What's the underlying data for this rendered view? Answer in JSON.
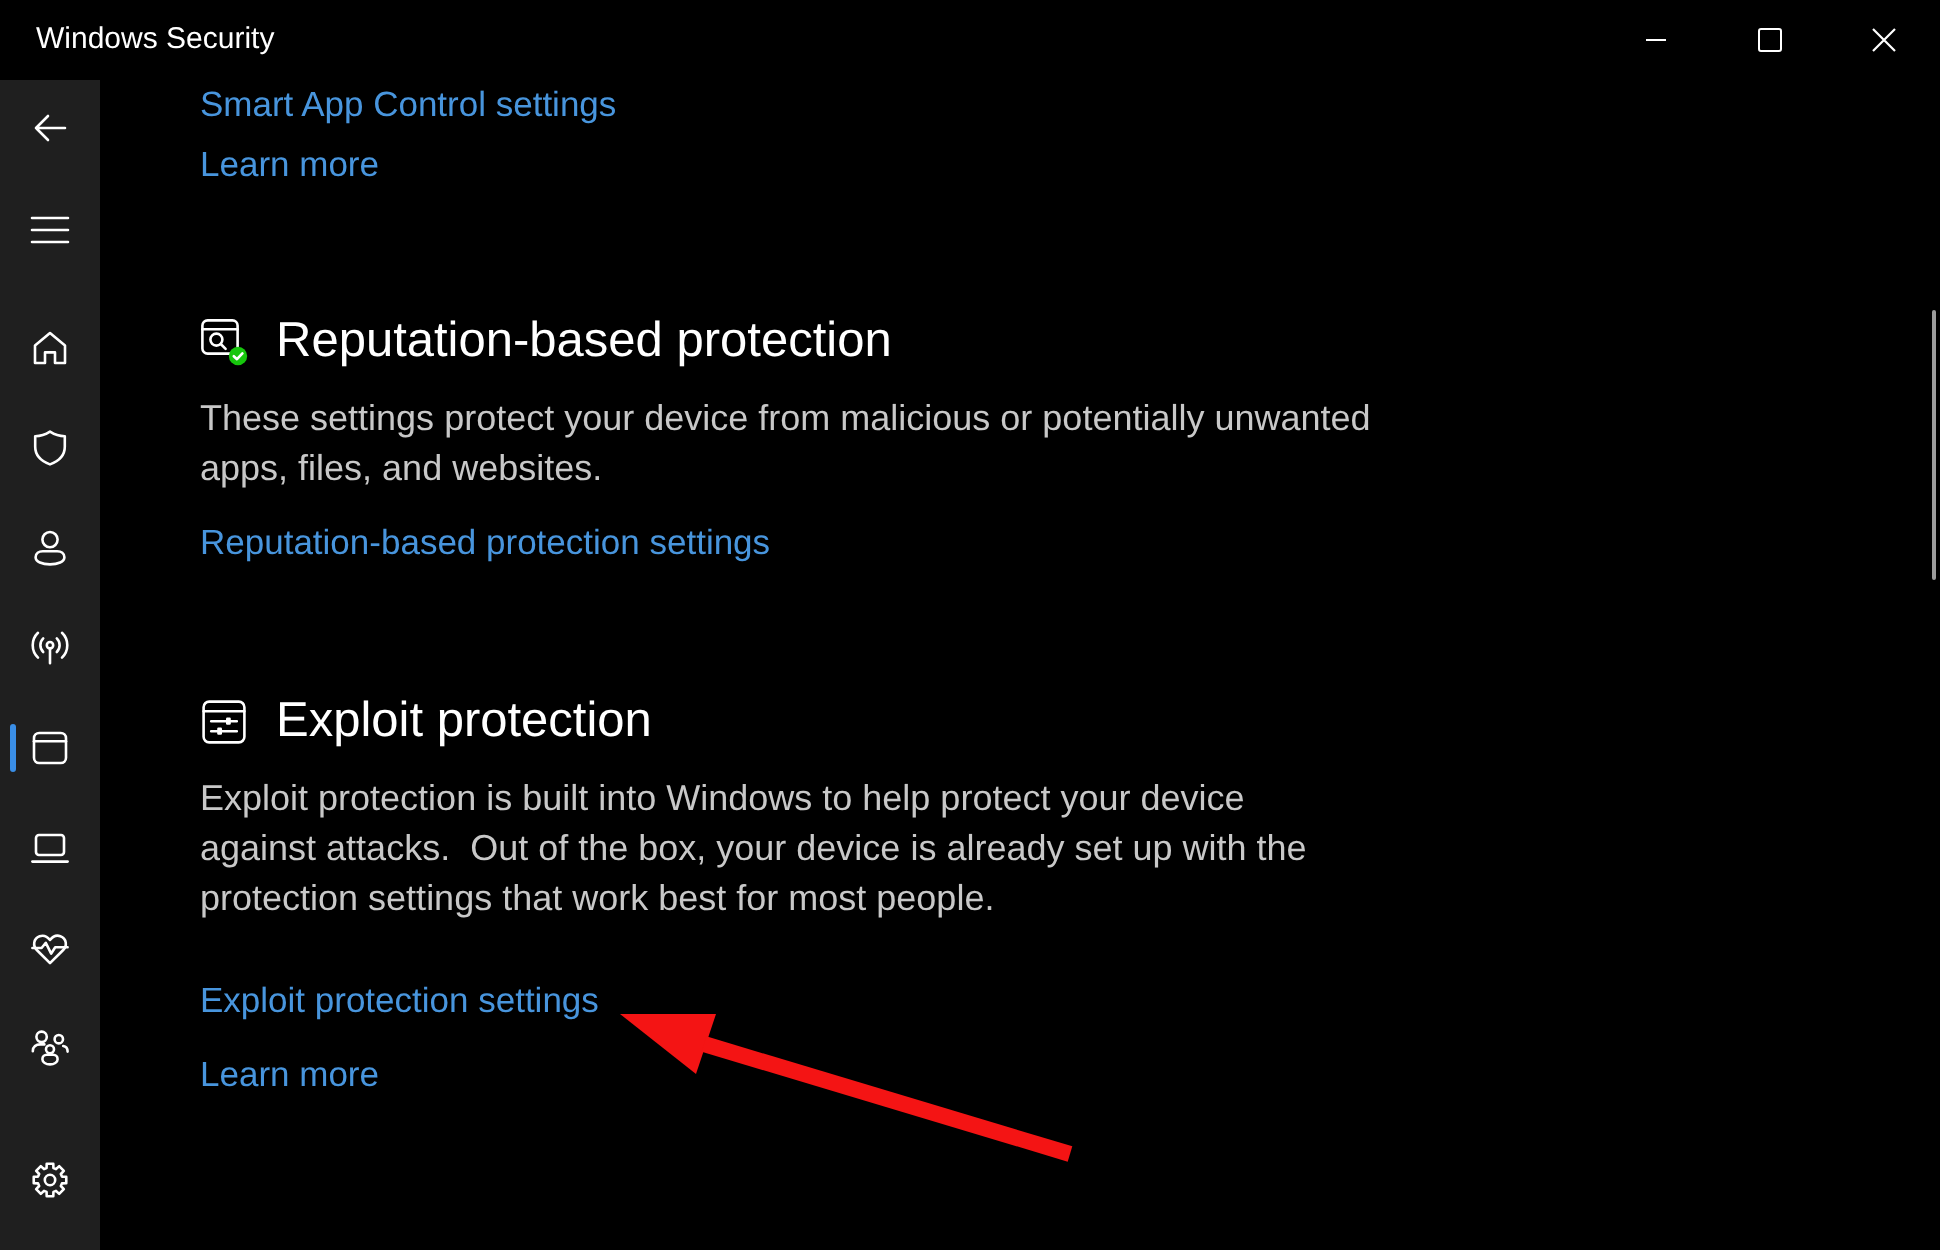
{
  "window": {
    "title": "Windows Security"
  },
  "sidebar": {
    "items": [
      {
        "selected": false
      },
      {
        "selected": false
      },
      {
        "selected": false
      },
      {
        "selected": false
      },
      {
        "selected": true
      },
      {
        "selected": false
      },
      {
        "selected": false
      },
      {
        "selected": false
      }
    ],
    "settings_item": {
      "selected": false
    }
  },
  "sections": [
    {
      "kind": "partial",
      "links": [
        "Smart App Control settings",
        "Learn more"
      ]
    },
    {
      "kind": "titled",
      "heading": "Reputation-based protection",
      "description": "These settings protect your device from malicious or potentially unwanted apps, files, and websites.",
      "links": [
        "Reputation-based protection settings"
      ]
    },
    {
      "kind": "titled",
      "heading": "Exploit protection",
      "description": "Exploit protection is built into Windows to help protect your device against attacks.  Out of the box, your device is already set up with the protection settings that work best for most people.",
      "links": [
        "Exploit protection settings",
        "Learn more"
      ]
    }
  ]
}
